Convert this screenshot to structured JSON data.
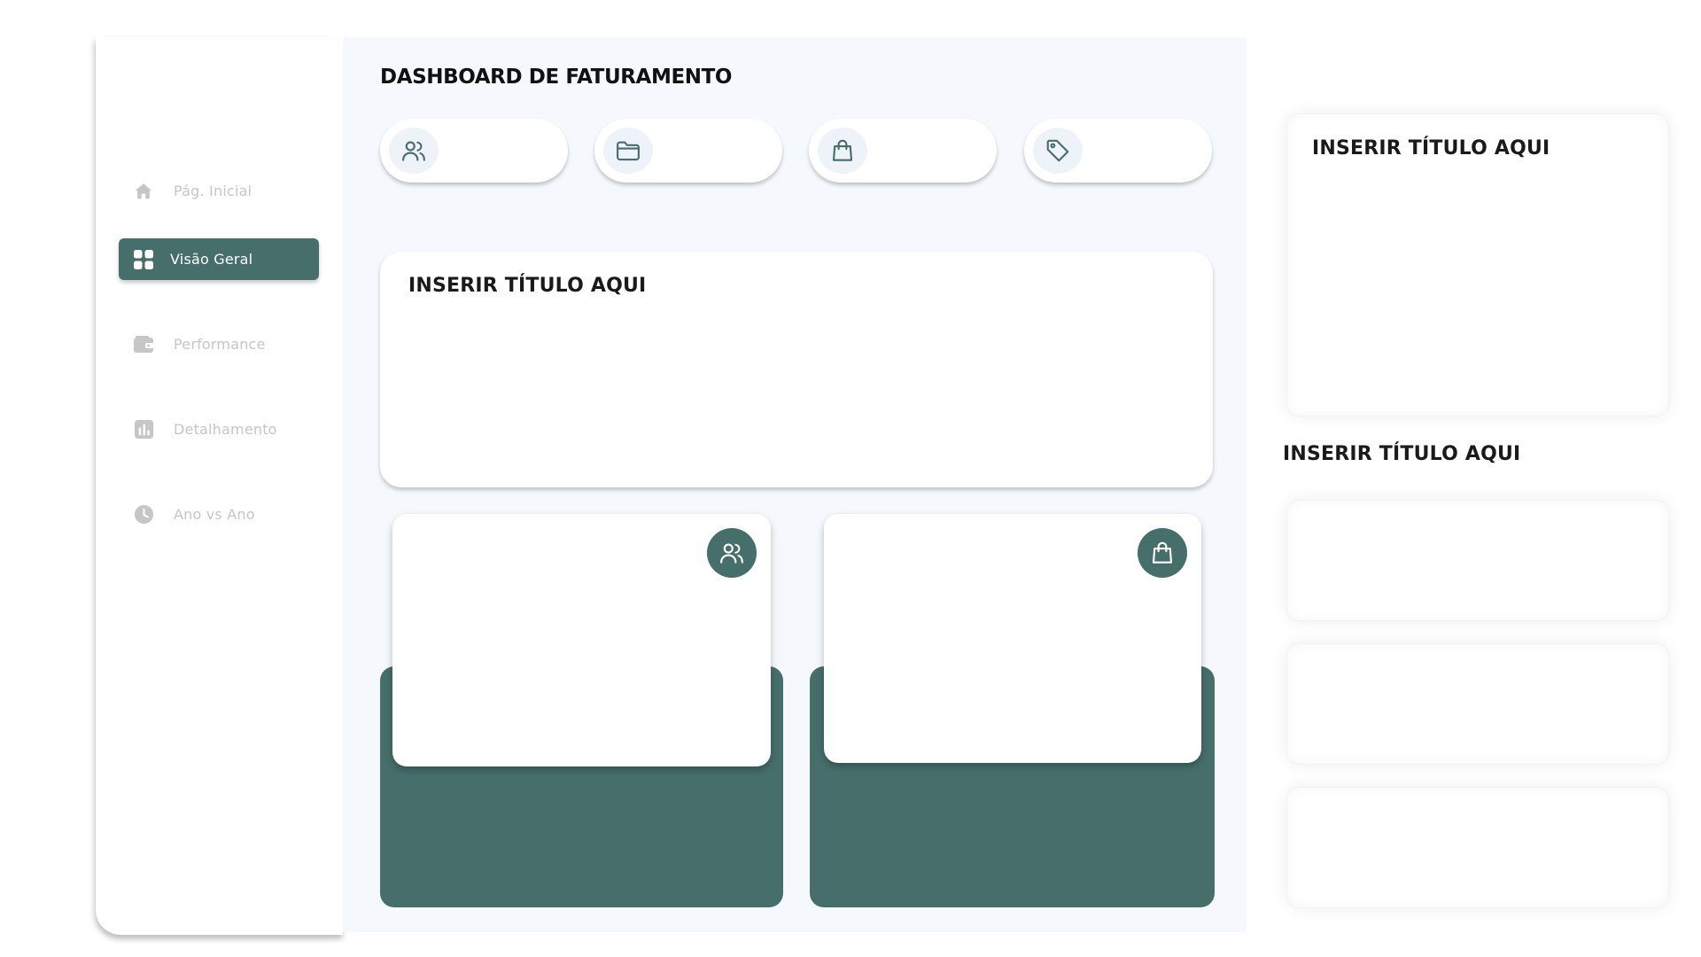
{
  "sidebar": {
    "items": [
      {
        "label": "Pág. Inicial",
        "icon": "home-icon",
        "active": false
      },
      {
        "label": "Visão Geral",
        "icon": "grid-icon",
        "active": true
      },
      {
        "label": "Performance",
        "icon": "wallet-icon",
        "active": false
      },
      {
        "label": "Detalhamento",
        "icon": "bar-chart-icon",
        "active": false
      },
      {
        "label": "Ano vs Ano",
        "icon": "clock-icon",
        "active": false
      }
    ]
  },
  "main": {
    "title": "DASHBOARD DE FATURAMENTO",
    "kpis": [
      {
        "icon": "users-icon"
      },
      {
        "icon": "folder-icon"
      },
      {
        "icon": "shopping-bag-icon"
      },
      {
        "icon": "tag-icon"
      }
    ],
    "big_card": {
      "title": "INSERIR TÍTULO AQUI"
    },
    "bottom_cards": [
      {
        "icon": "users-icon"
      },
      {
        "icon": "shopping-bag-icon"
      }
    ]
  },
  "right_panel": {
    "top_card_title": "INSERIR TÍTULO AQUI",
    "section_title": "INSERIR TÍTULO AQUI"
  },
  "colors": {
    "accent": "#466e6b",
    "main_background": "#f5f8fd",
    "inactive_text": "#c6c6c6"
  }
}
